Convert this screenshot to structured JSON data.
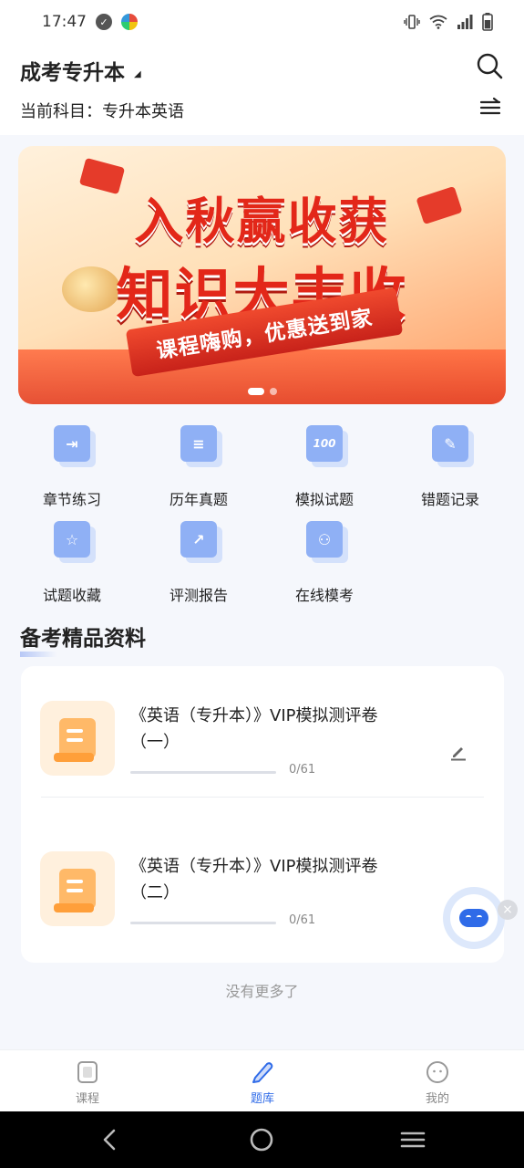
{
  "status_bar": {
    "time": "17:47"
  },
  "header": {
    "exam_title": "成考专升本",
    "current_subject": "当前科目：专升本英语"
  },
  "banner": {
    "line1": "入秋赢收获",
    "line2": "知识大丰收",
    "ribbon": "课程嗨购，优惠送到家",
    "slide_count": 2,
    "active_slide": 1
  },
  "features": [
    {
      "label": "章节练习",
      "icon": "chapter-practice-icon"
    },
    {
      "label": "历年真题",
      "icon": "past-exams-icon"
    },
    {
      "label": "模拟试题",
      "icon": "mock-questions-icon"
    },
    {
      "label": "错题记录",
      "icon": "wrong-questions-icon"
    },
    {
      "label": "试题收藏",
      "icon": "favorites-icon"
    },
    {
      "label": "评测报告",
      "icon": "report-icon"
    },
    {
      "label": "在线模考",
      "icon": "online-exam-icon"
    }
  ],
  "materials": {
    "section_title": "备考精品资料",
    "items": [
      {
        "title": "《英语（专升本）》VIP模拟测评卷（一）",
        "progress_text": "0/61",
        "progress": 0
      },
      {
        "title": "《英语（专升本）》VIP模拟测评卷（二）",
        "progress_text": "0/61",
        "progress": 0
      }
    ],
    "no_more": "没有更多了"
  },
  "tabbar": {
    "tabs": [
      {
        "label": "课程",
        "active": false
      },
      {
        "label": "题库",
        "active": true
      },
      {
        "label": "我的",
        "active": false
      }
    ]
  },
  "colors": {
    "accent": "#2f6be8",
    "icon_blue": "#8fb0f5",
    "banner_red": "#e32719"
  }
}
